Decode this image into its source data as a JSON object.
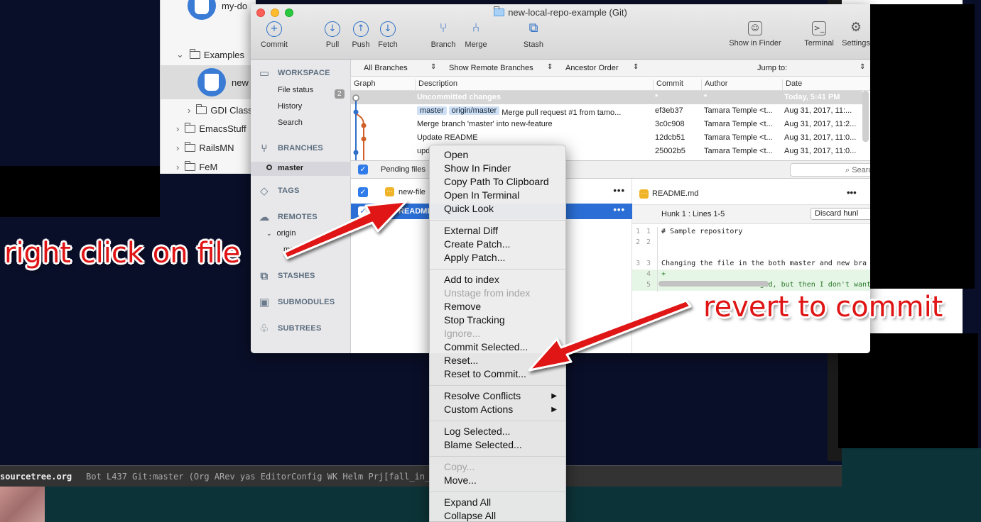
{
  "background_finder": {
    "items": [
      {
        "label": "my-do",
        "type": "repo"
      },
      {
        "label": "Examples",
        "type": "folder-open"
      },
      {
        "label": "new",
        "type": "repo"
      },
      {
        "label": "GDI Class",
        "type": "folder"
      },
      {
        "label": "EmacsStuff",
        "type": "folder"
      },
      {
        "label": "RailsMN",
        "type": "folder"
      },
      {
        "label": "FeM",
        "type": "folder"
      }
    ]
  },
  "window": {
    "title": "new-local-repo-example (Git)",
    "toolbar": [
      {
        "label": "Commit",
        "icon": "plus-circle-icon",
        "glyph": "+"
      },
      {
        "label": "Pull",
        "icon": "pull-icon",
        "glyph": "↓"
      },
      {
        "label": "Push",
        "icon": "push-icon",
        "glyph": "↑"
      },
      {
        "label": "Fetch",
        "icon": "fetch-icon",
        "glyph": "↓"
      },
      {
        "label": "Branch",
        "icon": "branch-icon",
        "glyph": "⑂"
      },
      {
        "label": "Merge",
        "icon": "merge-icon",
        "glyph": "⑃"
      },
      {
        "label": "Stash",
        "icon": "stash-icon",
        "glyph": "⧉"
      },
      {
        "label": "Show in Finder",
        "icon": "finder-icon",
        "glyph": "☺"
      },
      {
        "label": "Terminal",
        "icon": "terminal-icon",
        "glyph": ">_"
      },
      {
        "label": "Settings",
        "icon": "gear-icon",
        "glyph": "⚙"
      }
    ]
  },
  "sidebar": {
    "workspace": "WORKSPACE",
    "workspace_items": [
      "File status",
      "History",
      "Search"
    ],
    "file_status_count": "2",
    "branches": "BRANCHES",
    "branch_items": [
      "master"
    ],
    "tags": "TAGS",
    "remotes": "REMOTES",
    "remote_items": [
      "origin",
      "master"
    ],
    "stashes": "STASHES",
    "submodules": "SUBMODULES",
    "subtrees": "SUBTREES"
  },
  "filters": {
    "branches": "All Branches",
    "remote": "Show Remote Branches",
    "order": "Ancestor Order",
    "jump": "Jump to:"
  },
  "log": {
    "columns": [
      "Graph",
      "Description",
      "Commit",
      "Author",
      "Date"
    ],
    "rows": [
      {
        "tags": [],
        "description": "Uncommitted changes",
        "commit": "*",
        "author": "*",
        "date": "Today, 5:41 PM"
      },
      {
        "tags": [
          "master",
          "origin/master"
        ],
        "description": "Merge pull request #1 from tamo...",
        "commit": "ef3eb37",
        "author": "Tamara Temple <t...",
        "date": "Aug 31, 2017, 11:..."
      },
      {
        "tags": [],
        "description": "Merge branch 'master' into new-feature",
        "commit": "3c0c908",
        "author": "Tamara Temple <t...",
        "date": "Aug 31, 2017, 11:2..."
      },
      {
        "tags": [],
        "description": "Update README",
        "commit": "12dcb51",
        "author": "Tamara Temple <t...",
        "date": "Aug 31, 2017, 11:0..."
      },
      {
        "tags": [],
        "description": "upd",
        "commit": "25002b5",
        "author": "Tamara Temple <t...",
        "date": "Aug 31, 2017, 11:0..."
      }
    ]
  },
  "pending": {
    "label": "Pending files",
    "search_placeholder": "Search"
  },
  "files": [
    {
      "name": "new-file",
      "checked": true,
      "selected": false
    },
    {
      "name": "README",
      "checked": true,
      "selected": true
    }
  ],
  "diff": {
    "file": "README.md",
    "hunk": "Hunk 1 : Lines 1-5",
    "discard": "Discard hunl",
    "lines": [
      {
        "old": "1",
        "new": "1",
        "text": " # Sample repository",
        "type": "ctx"
      },
      {
        "old": "2",
        "new": "2",
        "text": "",
        "type": "ctx"
      },
      {
        "old": "3",
        "new": "3",
        "text": " Changing the file in the both master and new bra",
        "type": "ctx"
      },
      {
        "old": "",
        "new": "4",
        "text": "+",
        "type": "add"
      },
      {
        "old": "",
        "new": "5",
        "text": "+ This line will be staged, but then I don't want",
        "type": "add"
      }
    ]
  },
  "context_menu": {
    "groups": [
      [
        {
          "label": "Open"
        },
        {
          "label": "Show In Finder"
        },
        {
          "label": "Copy Path To Clipboard"
        },
        {
          "label": "Open In Terminal"
        },
        {
          "label": "Quick Look"
        }
      ],
      [
        {
          "label": "External Diff"
        },
        {
          "label": "Create Patch..."
        },
        {
          "label": "Apply Patch..."
        }
      ],
      [
        {
          "label": "Add to index"
        },
        {
          "label": "Unstage from index",
          "disabled": true
        },
        {
          "label": "Remove"
        },
        {
          "label": "Stop Tracking"
        },
        {
          "label": "Ignore...",
          "disabled": true
        },
        {
          "label": "Commit Selected..."
        },
        {
          "label": "Reset..."
        },
        {
          "label": "Reset to Commit..."
        }
      ],
      [
        {
          "label": "Resolve Conflicts",
          "submenu": true
        },
        {
          "label": "Custom Actions",
          "submenu": true
        }
      ],
      [
        {
          "label": "Log Selected..."
        },
        {
          "label": "Blame Selected..."
        }
      ],
      [
        {
          "label": "Copy...",
          "disabled": true
        },
        {
          "label": "Move..."
        }
      ],
      [
        {
          "label": "Expand All"
        },
        {
          "label": "Collapse All"
        }
      ]
    ]
  },
  "annotations": {
    "right_click": "right click on file",
    "revert": "revert to commit"
  },
  "statusbar": {
    "buffer": "sourcetree.org",
    "rest": "Bot L437  Git:master  (Org ARev yas EditorConfig WK Helm Prj[fall_in_"
  },
  "colors": {
    "accent": "#2f7bea",
    "selection": "#2b6fd6",
    "annotation": "#e01414",
    "graph_blue": "#2f6fc8",
    "graph_orange": "#d0602a"
  }
}
